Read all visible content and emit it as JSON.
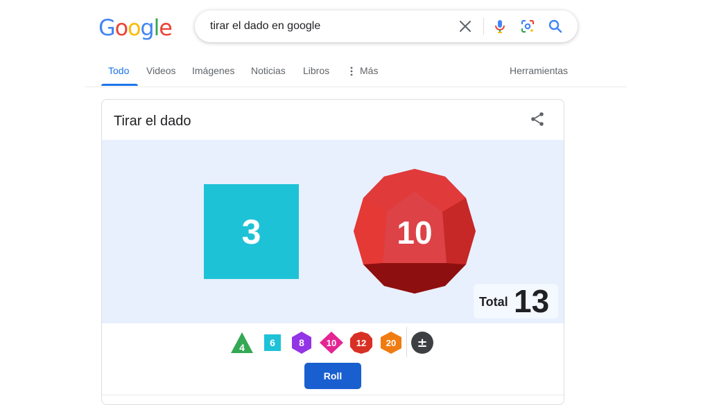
{
  "logo": {
    "letters": [
      "G",
      "o",
      "o",
      "g",
      "l",
      "e"
    ],
    "colors": [
      "#4285F4",
      "#EA4335",
      "#FBBC05",
      "#4285F4",
      "#34A853",
      "#EA4335"
    ]
  },
  "search": {
    "query": "tirar el dado en google"
  },
  "icons": {
    "clear": "close-icon",
    "voice": "microphone-icon",
    "lens": "lens-icon",
    "search": "search-icon",
    "share": "share-icon",
    "more": "more-vert-icon"
  },
  "tabs": [
    {
      "label": "Todo",
      "active": true
    },
    {
      "label": "Videos",
      "active": false
    },
    {
      "label": "Imágenes",
      "active": false
    },
    {
      "label": "Noticias",
      "active": false
    },
    {
      "label": "Libros",
      "active": false
    },
    {
      "label": "Más",
      "active": false
    }
  ],
  "tools_label": "Herramientas",
  "card": {
    "title": "Tirar el dado",
    "dice": [
      {
        "type": "d6",
        "value": "3",
        "color": "#1EC2D6"
      },
      {
        "type": "d12",
        "value": "10",
        "color": "#D32F2F"
      }
    ],
    "total_label": "Total",
    "total_value": "13",
    "die_options": [
      {
        "label": "4",
        "shape": "triangle",
        "color": "#34A853"
      },
      {
        "label": "6",
        "shape": "square",
        "color": "#1EC2D6"
      },
      {
        "label": "8",
        "shape": "hexagon",
        "color": "#9334E6"
      },
      {
        "label": "10",
        "shape": "diamond",
        "color": "#E52592"
      },
      {
        "label": "12",
        "shape": "decagon",
        "color": "#D93025"
      },
      {
        "label": "20",
        "shape": "hexagon",
        "color": "#F07B11"
      },
      {
        "label": "±",
        "shape": "circle",
        "color": "#3C4043"
      }
    ],
    "roll_label": "Roll"
  },
  "colors": {
    "accent": "#1A73E8",
    "roll_button": "#1A5FD0",
    "dice_bg": "#E8F0FE"
  }
}
